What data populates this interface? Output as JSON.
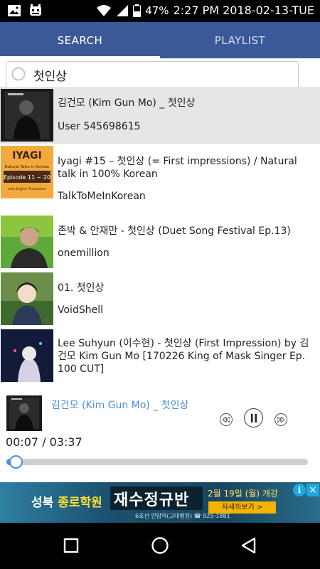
{
  "status_bar": {
    "battery": "47%",
    "clock": "2:27 PM 2018-02-13-TUE"
  },
  "tabs": [
    {
      "label": "SEARCH",
      "active": true
    },
    {
      "label": "PLAYLIST",
      "active": false
    }
  ],
  "search": {
    "query": "첫인상"
  },
  "results": [
    {
      "title": "김건모 (Kim Gun Mo) _ 첫인상",
      "channel": "User 545698615",
      "selected": true
    },
    {
      "title": "Iyagi #15 – 첫인상 (= First impressions) / Natural talk in 100% Korean",
      "channel": "TalkToMeInKorean",
      "selected": false,
      "thumb_text": {
        "brand": "IYAGI",
        "line1": "Natural Talks in Korean",
        "line2": "Episode 11 ~ 20",
        "line3": "with English Translation"
      }
    },
    {
      "title": "존박 & 안재만 - 첫인상 (Duet Song Festival Ep.13)",
      "channel": "onemillion",
      "selected": false
    },
    {
      "title": "01. 첫인상",
      "channel": "VoidShell",
      "selected": false
    },
    {
      "title": "Lee Suhyun (이수현) - 첫인상 (First Impression) by 김건모 Kim Gun Mo [170226 King of Mask Singer Ep. 100 CUT]",
      "channel": "",
      "selected": false
    }
  ],
  "player": {
    "title": "김건모 (Kim Gun Mo) _ 첫인상",
    "time": "00:07 / 03:37",
    "progress": 0.032
  },
  "ad": {
    "left_text_a": "성북",
    "left_text_b": "종로학원",
    "headline": "재수정규반",
    "date": "2월 19일 (월) 개강",
    "button": "자세히보기 >",
    "footer": "6호선 안암역(고대병원) ☎ 925-1881"
  },
  "colors": {
    "tab_bar": "#3b5998",
    "accent": "#4a90d9"
  }
}
